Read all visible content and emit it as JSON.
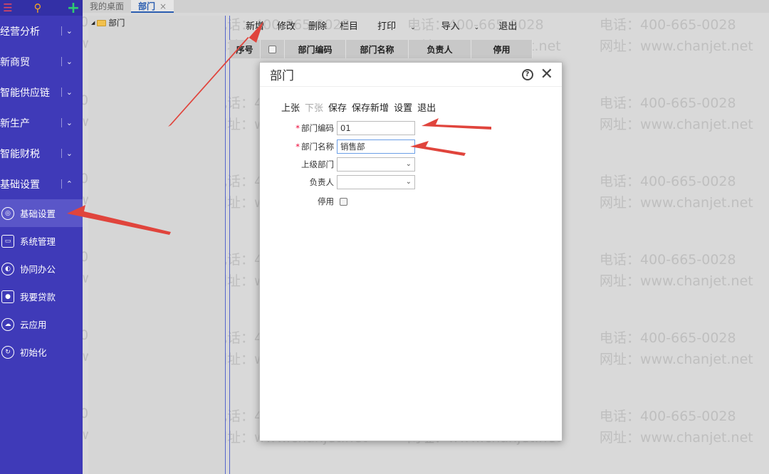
{
  "sidebar": {
    "top_icons": [
      "menu-icon",
      "search-icon",
      "plus-icon"
    ],
    "items": [
      {
        "label": "经营分析"
      },
      {
        "label": "新商贸"
      },
      {
        "label": "智能供应链"
      },
      {
        "label": "新生产"
      },
      {
        "label": "智能财税"
      },
      {
        "label": "基础设置"
      }
    ],
    "sub_items": [
      {
        "label": "基础设置",
        "icon": "settings-circle-icon"
      },
      {
        "label": "系统管理",
        "icon": "monitor-icon"
      },
      {
        "label": "协同办公",
        "icon": "collaboration-icon"
      },
      {
        "label": "我要贷款",
        "icon": "money-icon"
      },
      {
        "label": "云应用",
        "icon": "cloud-icon"
      },
      {
        "label": "初始化",
        "icon": "refresh-icon"
      }
    ]
  },
  "tabs": [
    {
      "label": "我的桌面"
    },
    {
      "label": "部门",
      "close": "×"
    }
  ],
  "tree": {
    "root_label": "部门",
    "expander": "◢"
  },
  "toolbar": {
    "add": "新增",
    "edit": "修改",
    "delete": "删除",
    "columns": "栏目",
    "print": "打印",
    "import": "导入",
    "exit": "退出",
    "caret": "⌄"
  },
  "grid": {
    "headers": [
      "序号",
      "",
      "部门编码",
      "部门名称",
      "负责人",
      "停用"
    ]
  },
  "dialog": {
    "title": "部门",
    "help": "?",
    "close": "✕",
    "toolbar": {
      "prev": "上张",
      "next": "下张",
      "save": "保存",
      "save_new": "保存新增",
      "settings": "设置",
      "exit": "退出"
    },
    "fields": {
      "code_label": "部门编码",
      "code_value": "01",
      "name_label": "部门名称",
      "name_value": "销售部",
      "parent_label": "上级部门",
      "parent_value": "",
      "manager_label": "负责人",
      "manager_value": "",
      "disabled_label": "停用",
      "required_mark": "*"
    }
  },
  "watermark": {
    "phone": "电话：400-665-0028",
    "site": "网址：www.chanjet.net",
    "phone_short": "400-665-0028",
    "site_short": "www.chanjet.net"
  },
  "colors": {
    "sidebar_bg": "#3f3ab8",
    "accent": "#2a5db0",
    "arrow": "#e0443c"
  }
}
